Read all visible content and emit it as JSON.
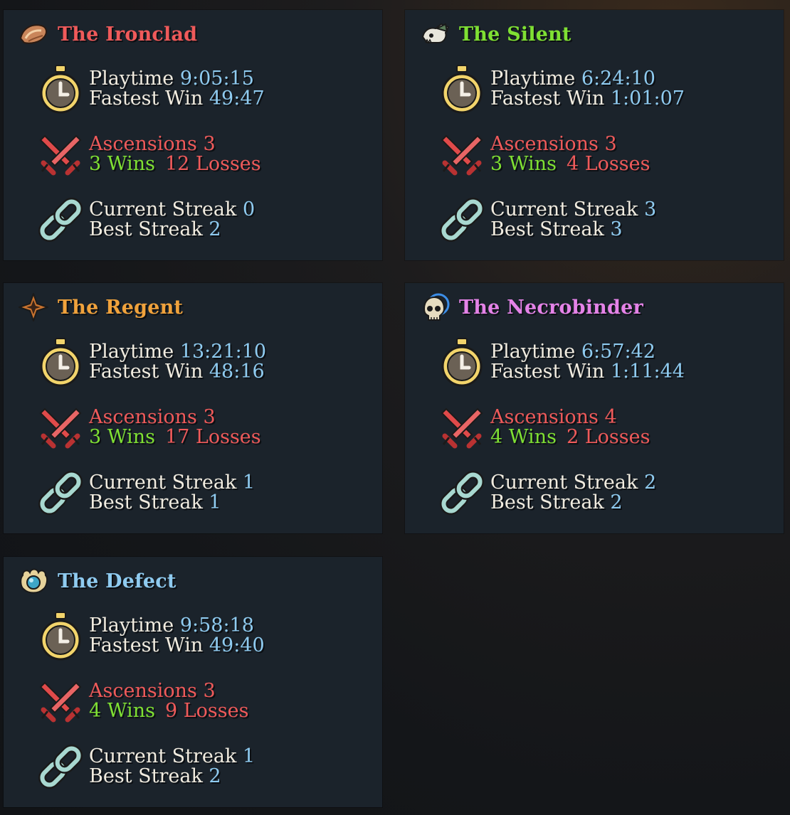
{
  "labels": {
    "playtime": "Playtime",
    "fastest_win": "Fastest Win",
    "ascensions": "Ascensions",
    "wins": "Wins",
    "losses": "Losses",
    "current_streak": "Current Streak",
    "best_streak": "Best Streak"
  },
  "characters": [
    {
      "name": "The Ironclad",
      "color": "#ef5a5a",
      "icon": "ironclad-icon",
      "playtime": "9:05:15",
      "fastest_win": "49:47",
      "ascensions": "3",
      "wins": "3",
      "losses": "12",
      "current_streak": "0",
      "best_streak": "2"
    },
    {
      "name": "The Silent",
      "color": "#7fe033",
      "icon": "silent-icon",
      "playtime": "6:24:10",
      "fastest_win": "1:01:07",
      "ascensions": "3",
      "wins": "3",
      "losses": "4",
      "current_streak": "3",
      "best_streak": "3"
    },
    {
      "name": "The Regent",
      "color": "#f0a23c",
      "icon": "regent-icon",
      "playtime": "13:21:10",
      "fastest_win": "48:16",
      "ascensions": "3",
      "wins": "3",
      "losses": "17",
      "current_streak": "1",
      "best_streak": "1"
    },
    {
      "name": "The Necrobinder",
      "color": "#e583e8",
      "icon": "necrobinder-icon",
      "playtime": "6:57:42",
      "fastest_win": "1:11:44",
      "ascensions": "4",
      "wins": "4",
      "losses": "2",
      "current_streak": "2",
      "best_streak": "2"
    },
    {
      "name": "The Defect",
      "color": "#8fcbf0",
      "icon": "defect-icon",
      "playtime": "9:58:18",
      "fastest_win": "49:40",
      "ascensions": "3",
      "wins": "4",
      "losses": "9",
      "current_streak": "1",
      "best_streak": "2"
    }
  ]
}
